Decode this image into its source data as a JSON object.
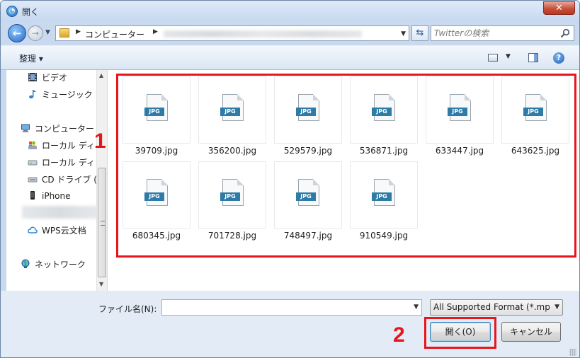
{
  "window": {
    "title": "開く"
  },
  "nav": {
    "breadcrumb": "コンピューター",
    "search_placeholder": "Twitterの検索"
  },
  "toolbar": {
    "organize_label": "整理 ▾"
  },
  "navpane": {
    "items": [
      {
        "label": "ビデオ",
        "icon": "film-icon"
      },
      {
        "label": "ミュージック",
        "icon": "music-icon"
      },
      {
        "label": "コンピューター",
        "icon": "computer-icon"
      },
      {
        "label": "ローカル ディ",
        "icon": "local-disk-windows-icon"
      },
      {
        "label": "ローカル ディ",
        "icon": "local-disk-icon"
      },
      {
        "label": "CD ドライブ (",
        "icon": "cd-drive-icon"
      },
      {
        "label": "iPhone",
        "icon": "phone-icon"
      },
      {
        "label": "WPS云文档",
        "icon": "cloud-icon"
      },
      {
        "label": "ネットワーク",
        "icon": "network-icon"
      }
    ]
  },
  "files": [
    {
      "name": "39709.jpg",
      "tag": "JPG"
    },
    {
      "name": "356200.jpg",
      "tag": "JPG"
    },
    {
      "name": "529579.jpg",
      "tag": "JPG"
    },
    {
      "name": "536871.jpg",
      "tag": "JPG"
    },
    {
      "name": "633447.jpg",
      "tag": "JPG"
    },
    {
      "name": "643625.jpg",
      "tag": "JPG"
    },
    {
      "name": "680345.jpg",
      "tag": "JPG"
    },
    {
      "name": "701728.jpg",
      "tag": "JPG"
    },
    {
      "name": "748497.jpg",
      "tag": "JPG"
    },
    {
      "name": "910549.jpg",
      "tag": "JPG"
    }
  ],
  "bottom": {
    "filename_label": "ファイル名(N):",
    "filename_value": "",
    "filter_value": "All Supported Format (*.mp",
    "open_label": "開く(O)",
    "cancel_label": "キャンセル"
  },
  "annotations": {
    "step1": "1",
    "step2": "2",
    "color": "#e8151b"
  }
}
